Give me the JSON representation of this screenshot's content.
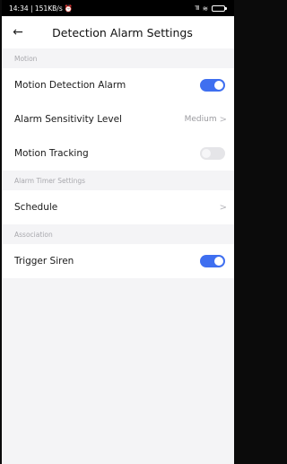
{
  "status": {
    "time_speed": "14:34 | 151KB/s",
    "alarm_glyph": "⏰",
    "signal": "᪲ıll",
    "wifi": "≋"
  },
  "header": {
    "back_glyph": "←",
    "title": "Detection Alarm Settings"
  },
  "sections": {
    "motion": {
      "title": "Motion",
      "motion_detection_alarm": {
        "label": "Motion Detection Alarm",
        "enabled": true
      },
      "alarm_sensitivity": {
        "label": "Alarm Sensitivity Level",
        "value": "Medium"
      },
      "motion_tracking": {
        "label": "Motion Tracking",
        "enabled": false
      }
    },
    "timer": {
      "title": "Alarm Timer Settings",
      "schedule": {
        "label": "Schedule"
      }
    },
    "association": {
      "title": "Association",
      "trigger_siren": {
        "label": "Trigger Siren",
        "enabled": true
      }
    }
  },
  "chevron_glyph": ">",
  "colors": {
    "accent": "#3f6ff0",
    "toggle_off": "#e5e5e8",
    "background": "#f4f4f6"
  }
}
